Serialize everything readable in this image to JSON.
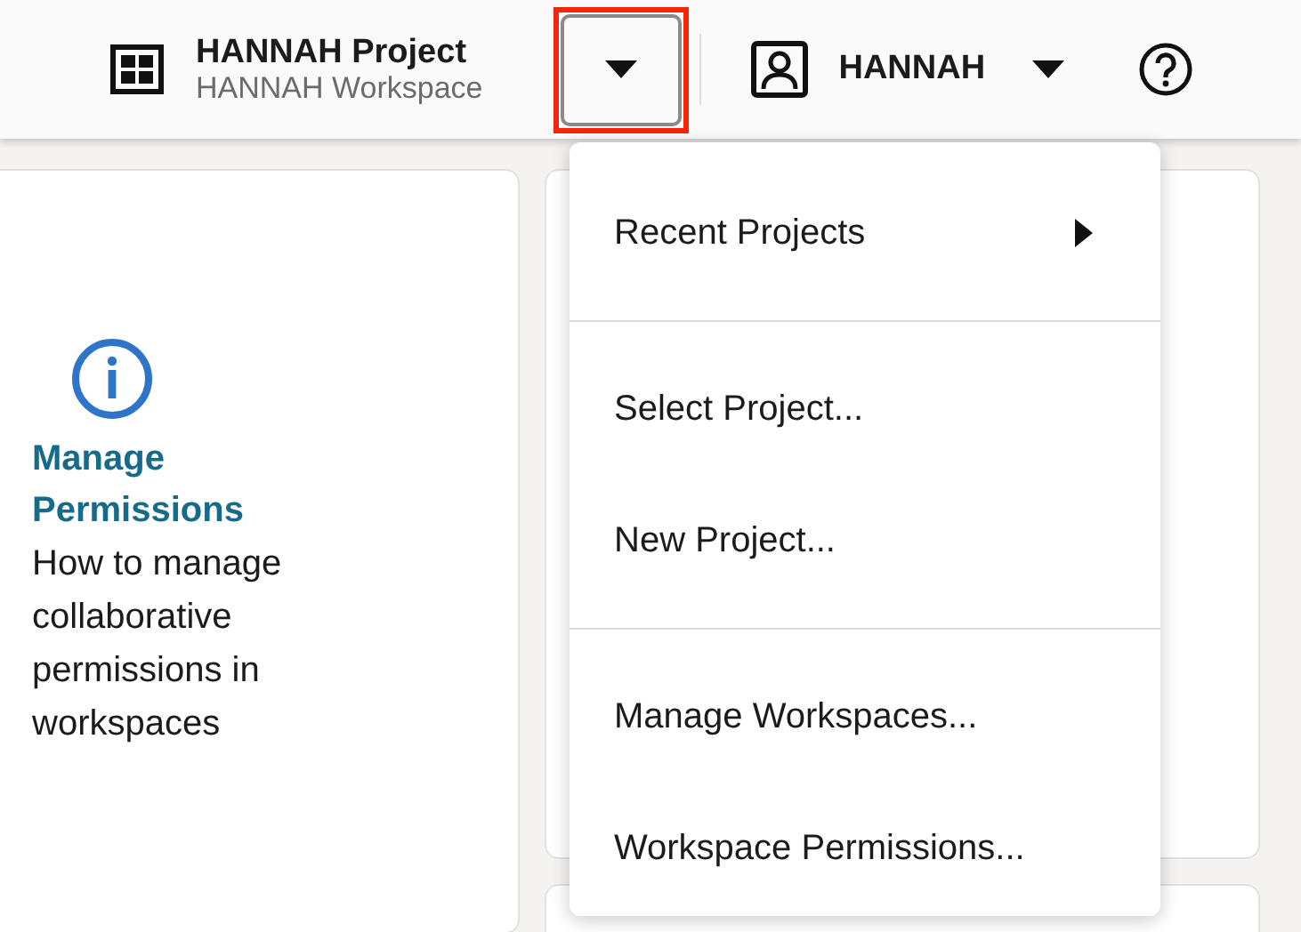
{
  "header": {
    "project_title": "HANNAH Project",
    "workspace_subtitle": "HANNAH Workspace",
    "project_dropdown": {
      "expanded": true,
      "highlighted": true
    },
    "user_name": "HANNAH"
  },
  "info_card": {
    "title": "Manage Permissions",
    "description": "How to manage collaborative permissions in workspaces"
  },
  "project_menu": {
    "groups": [
      [
        {
          "label": "Recent Projects",
          "kind": "submenu"
        }
      ],
      [
        {
          "label": "Select Project...",
          "kind": "action"
        },
        {
          "label": "New Project...",
          "kind": "action"
        }
      ],
      [
        {
          "label": "Manage Workspaces...",
          "kind": "action"
        },
        {
          "label": "Workspace Permissions...",
          "kind": "action"
        }
      ]
    ]
  }
}
